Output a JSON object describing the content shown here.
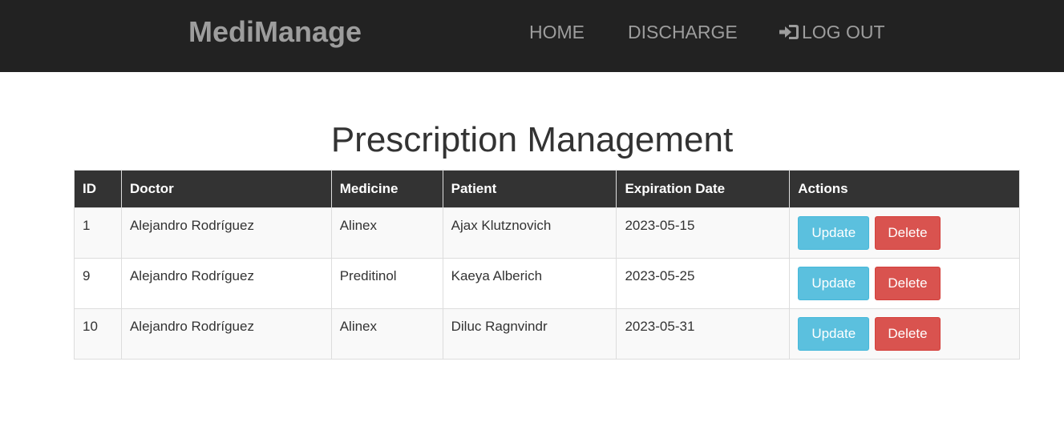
{
  "navbar": {
    "brand": "MediManage",
    "links": [
      {
        "label": "HOME"
      },
      {
        "label": "DISCHARGE"
      },
      {
        "label": "LOG OUT",
        "icon": "log-in-icon"
      }
    ],
    "background": "#222222",
    "text_color": "#9d9d9d"
  },
  "page": {
    "title": "Prescription Management"
  },
  "table": {
    "headers": [
      "ID",
      "Doctor",
      "Medicine",
      "Patient",
      "Expiration Date",
      "Actions"
    ],
    "rows": [
      {
        "id": "1",
        "doctor": "Alejandro Rodríguez",
        "medicine": "Alinex",
        "patient": "Ajax Klutznovich",
        "expiration": "2023-05-15"
      },
      {
        "id": "9",
        "doctor": "Alejandro Rodríguez",
        "medicine": "Preditinol",
        "patient": "Kaeya Alberich",
        "expiration": "2023-05-25"
      },
      {
        "id": "10",
        "doctor": "Alejandro Rodríguez",
        "medicine": "Alinex",
        "patient": "Diluc Ragnvindr",
        "expiration": "2023-05-31"
      }
    ],
    "update_label": "Update",
    "delete_label": "Delete",
    "header_background": "#333333",
    "update_color": "#5bc0de",
    "delete_color": "#d9534f"
  }
}
